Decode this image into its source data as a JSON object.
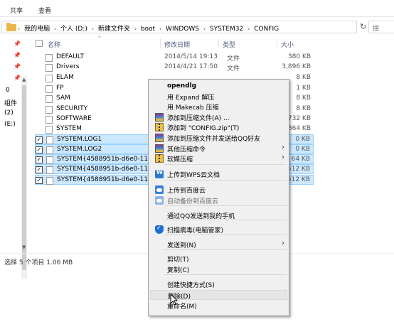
{
  "ribbon": {
    "tabs": [
      "共享",
      "查看"
    ]
  },
  "address": {
    "breadcrumb": [
      "我的电脑",
      "个人 (D:)",
      "新建文件夹",
      "boot",
      "WINDOWS",
      "SYSTEM32",
      "CONFIG"
    ],
    "search_placeholder": "搜"
  },
  "nav": {
    "labels": [
      "0",
      "组件",
      "(2)",
      "(E:)"
    ]
  },
  "columns": {
    "name": "名称",
    "date": "修改日期",
    "type": "类型",
    "size": "大小"
  },
  "files": [
    {
      "name": "DEFAULT",
      "date": "2014/5/14 19:13",
      "type": "文件",
      "size": "380 KB",
      "icon": "doc-icon",
      "selected": false
    },
    {
      "name": "Drivers",
      "date": "2014/4/21 17:50",
      "type": "文件",
      "size": "3,896 KB",
      "icon": "doc-icon",
      "selected": false
    },
    {
      "name": "ELAM",
      "date": "",
      "type": "",
      "size": "8 KB",
      "icon": "doc-icon",
      "selected": false
    },
    {
      "name": "FP",
      "date": "",
      "type": "",
      "size": "1 KB",
      "icon": "doc-icon",
      "selected": false
    },
    {
      "name": "SAM",
      "date": "",
      "type": "",
      "size": "8 KB",
      "icon": "doc-icon",
      "selected": false
    },
    {
      "name": "SECURITY",
      "date": "",
      "type": "",
      "size": "8 KB",
      "icon": "doc-icon",
      "selected": false
    },
    {
      "name": "SOFTWARE",
      "date": "",
      "type": "",
      "size": "9,732 KB",
      "icon": "doc-icon",
      "selected": false
    },
    {
      "name": "SYSTEM",
      "date": "",
      "type": "",
      "size": "4,864 KB",
      "icon": "doc-icon",
      "selected": false
    },
    {
      "name": "SYSTEM.LOG1",
      "date": "",
      "type": "",
      "size": "0 KB",
      "icon": "doc-icon",
      "selected": true
    },
    {
      "name": "SYSTEM.LOG2",
      "date": "",
      "type": "",
      "size": "0 KB",
      "icon": "doc-icon",
      "selected": true
    },
    {
      "name": "SYSTEM{4588951b-d6e0-11e1-b7",
      "date": "",
      "type": "",
      "size": "64 KB",
      "icon": "doc-icon",
      "selected": true
    },
    {
      "name": "SYSTEM{4588951b-d6e0-11e1-b7",
      "date": "",
      "type": "",
      "size": "512 KB",
      "icon": "doc-icon",
      "selected": true
    },
    {
      "name": "SYSTEM{4588951b-d6e0-11e1-b7",
      "date": "",
      "type": "",
      "size": "512 KB",
      "icon": "doc-icon",
      "selected": true
    }
  ],
  "status": {
    "text": "选择 5 个项目  1.06 MB"
  },
  "context_menu": {
    "items": [
      {
        "label": "opendlg",
        "bold": true,
        "icon": ""
      },
      {
        "label": "用 Expand 解压",
        "icon": ""
      },
      {
        "label": "用 Makecab 压缩",
        "icon": ""
      },
      {
        "label": "添加到压缩文件(A) ...",
        "icon": "rar-icon"
      },
      {
        "label": "添加到 \"CONFIG.zip\"(T)",
        "icon": "zip-icon"
      },
      {
        "label": "添加到压缩文件并发送给QQ好友",
        "icon": "rar-icon"
      },
      {
        "label": "其他压缩命令",
        "icon": "rar-icon",
        "submenu": true
      },
      {
        "label": "软媒压缩",
        "icon": "zip-icon",
        "submenu": true
      },
      {
        "label": "上传到WPS云文档",
        "icon": "wps-icon"
      },
      {
        "label": "上传到百度云",
        "icon": "cloud-icon"
      },
      {
        "label": "自动备份到百度云",
        "icon": "cloud-icon",
        "dim": true
      },
      {
        "label": "通过QQ发送到我的手机",
        "icon": ""
      },
      {
        "label": "扫描病毒(电脑管家)",
        "icon": "shield-icon"
      },
      {
        "label": "发送到(N)",
        "icon": "",
        "submenu": true
      },
      {
        "label": "剪切(T)",
        "icon": ""
      },
      {
        "label": "复制(C)",
        "icon": ""
      },
      {
        "label": "创建快捷方式(S)",
        "icon": ""
      },
      {
        "label": "删除(D)",
        "icon": "",
        "hover": true
      },
      {
        "label": "重命名(M)",
        "icon": ""
      }
    ]
  }
}
